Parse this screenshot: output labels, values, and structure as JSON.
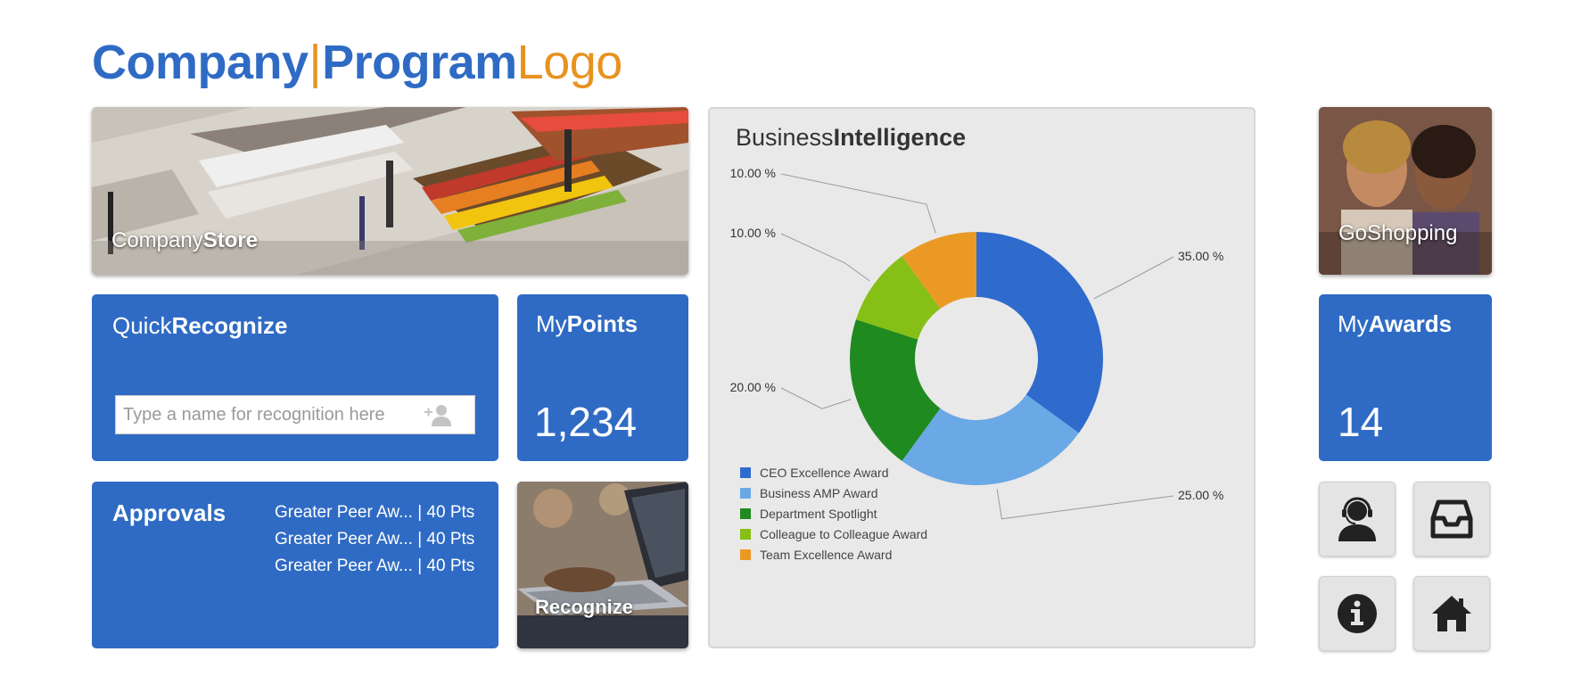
{
  "logo": {
    "company": "Company",
    "separator": "|",
    "program": "Program",
    "logo": "Logo"
  },
  "store": {
    "caption_light": "Company",
    "caption_bold": "Store"
  },
  "shop": {
    "caption": "GoShopping"
  },
  "quick_recognize": {
    "title_light": "Quick",
    "title_bold": "Recognize",
    "placeholder": "Type a name for recognition here",
    "icon": "add-user-icon"
  },
  "my_points": {
    "title_light": "My",
    "title_bold": "Points",
    "value": "1,234"
  },
  "approvals": {
    "title": "Approvals",
    "items": [
      {
        "name": "Greater Peer Aw...",
        "sep": "|",
        "points": "40 Pts"
      },
      {
        "name": "Greater Peer Aw...",
        "sep": "|",
        "points": "40 Pts"
      },
      {
        "name": "Greater Peer Aw...",
        "sep": "|",
        "points": "40 Pts"
      }
    ]
  },
  "recognize": {
    "caption": "Recognize"
  },
  "business_intelligence": {
    "title_light": "Business",
    "title_bold": "Intelligence"
  },
  "chart_data": {
    "type": "pie",
    "donut": true,
    "title": "BusinessIntelligence",
    "legend_position": "bottom-left",
    "series": [
      {
        "name": "CEO Excellence Award",
        "value": 35.0,
        "label": "35.00 %",
        "color": "#2f6bcc"
      },
      {
        "name": "Business AMP Award",
        "value": 25.0,
        "label": "25.00 %",
        "color": "#6aa8e6"
      },
      {
        "name": "Department Spotlight",
        "value": 20.0,
        "label": "20.00 %",
        "color": "#1f8a1f"
      },
      {
        "name": "Colleague to Colleague Award",
        "value": 10.0,
        "label": "10.00 %",
        "color": "#86bf16"
      },
      {
        "name": "Team Excellence Award",
        "value": 10.0,
        "label": "10.00 %",
        "color": "#ea9a24"
      }
    ]
  },
  "my_awards": {
    "title_light": "My",
    "title_bold": "Awards",
    "value": "14"
  },
  "icon_buttons": [
    {
      "icon": "support-agent-icon"
    },
    {
      "icon": "inbox-icon"
    },
    {
      "icon": "info-icon"
    },
    {
      "icon": "home-icon"
    }
  ],
  "colors": {
    "tile_blue": "#2f6bc4",
    "accent_orange": "#e8921f",
    "panel_gray": "#e9e9e9"
  }
}
